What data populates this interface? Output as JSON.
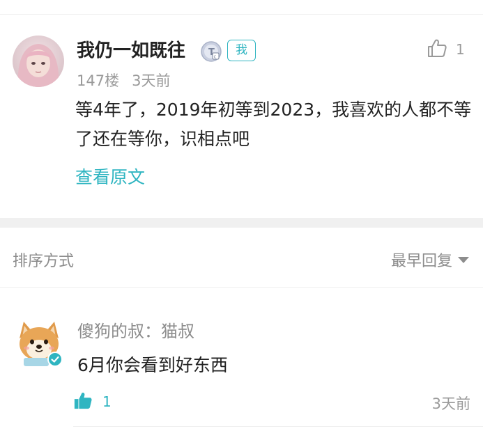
{
  "post": {
    "username": "我仍一如既往",
    "me_badge": "我",
    "like_count": "1",
    "floor": "147楼",
    "time": "3天前",
    "content": "等4年了，2019年初等到2023，我喜欢的人都不等了还在等你，识相点吧",
    "view_original": "查看原文"
  },
  "sort": {
    "title": "排序方式",
    "selected": "最早回复"
  },
  "reply": {
    "author": "傻狗的叔：猫叔",
    "text": "6月你会看到好东西",
    "like_count": "1",
    "time": "3天前"
  },
  "colors": {
    "accent": "#2fb5c1",
    "muted": "#9a9a9a",
    "text": "#222222",
    "divider": "#f0f0f0"
  },
  "icons": {
    "like_outline": "thumbs-up-outline-icon",
    "like_filled": "thumbs-up-filled-icon",
    "level": "level-badge-icon",
    "verified": "verified-check-icon",
    "dropdown": "caret-down-icon"
  }
}
